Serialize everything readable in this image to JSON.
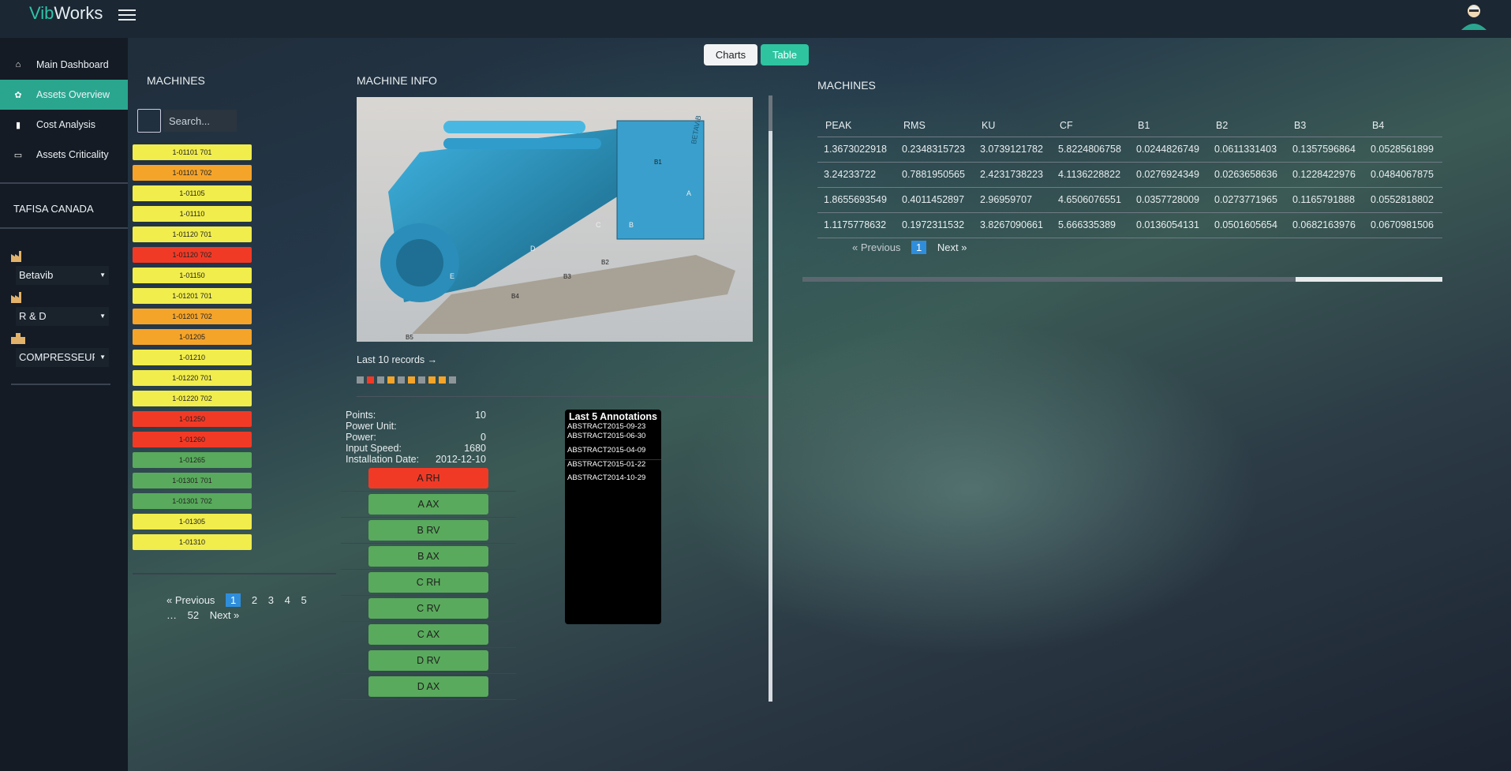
{
  "app": {
    "logo_part1": "Vib",
    "logo_part2": "Works"
  },
  "sidebar": {
    "nav": [
      {
        "label": "Main Dashboard",
        "icon": "home-icon",
        "glyph": "⌂"
      },
      {
        "label": "Assets Overview",
        "icon": "gear-icon",
        "glyph": "✿"
      },
      {
        "label": "Cost Analysis",
        "icon": "bar-chart-icon",
        "glyph": "▮"
      },
      {
        "label": "Assets Criticality",
        "icon": "monitor-icon",
        "glyph": "▭"
      }
    ],
    "company": "TAFISA CANADA",
    "selects": [
      {
        "value": "Betavib",
        "icon": "factory-icon"
      },
      {
        "value": "R & D",
        "icon": "factory-icon"
      },
      {
        "value": "COMPRESSEUR",
        "icon": "building-icon"
      }
    ]
  },
  "machines_panel": {
    "title": "MACHINES",
    "search_placeholder": "Search...",
    "items": [
      {
        "label": "1-01101 701",
        "color": "yellow"
      },
      {
        "label": "1-01101 702",
        "color": "orange"
      },
      {
        "label": "1-01105",
        "color": "yellow"
      },
      {
        "label": "1-01110",
        "color": "yellow"
      },
      {
        "label": "1-01120 701",
        "color": "yellow"
      },
      {
        "label": "1-01120 702",
        "color": "red"
      },
      {
        "label": "1-01150",
        "color": "yellow"
      },
      {
        "label": "1-01201 701",
        "color": "yellow"
      },
      {
        "label": "1-01201 702",
        "color": "orange"
      },
      {
        "label": "1-01205",
        "color": "orange"
      },
      {
        "label": "1-01210",
        "color": "yellow"
      },
      {
        "label": "1-01220 701",
        "color": "yellow"
      },
      {
        "label": "1-01220 702",
        "color": "yellow"
      },
      {
        "label": "1-01250",
        "color": "red"
      },
      {
        "label": "1-01260",
        "color": "red"
      },
      {
        "label": "1-01265",
        "color": "green"
      },
      {
        "label": "1-01301 701",
        "color": "green"
      },
      {
        "label": "1-01301 702",
        "color": "green"
      },
      {
        "label": "1-01305",
        "color": "yellow"
      },
      {
        "label": "1-01310",
        "color": "yellow"
      }
    ],
    "pager": {
      "prev": "« Previous",
      "pages": [
        "1",
        "2",
        "3",
        "4",
        "5"
      ],
      "active": "1",
      "ellipsis": "…",
      "last": "52",
      "next": "Next »"
    }
  },
  "machine_info": {
    "title": "MACHINE INFO",
    "last_records": "Last 10 records →",
    "status_colors": [
      "#8e9599",
      "#f13a26",
      "#8e9599",
      "#f5a42a",
      "#8e9599",
      "#f5a42a",
      "#8e9599",
      "#f5a42a",
      "#f5a42a",
      "#8e9599"
    ],
    "image_labels": [
      "B1",
      "A",
      "C",
      "B",
      "D",
      "E",
      "B2",
      "B3",
      "B4",
      "B5"
    ],
    "brand_text": "BETAVIB",
    "stats": [
      {
        "label": "Points:",
        "value": "10"
      },
      {
        "label": "Power Unit:",
        "value": ""
      },
      {
        "label": "Power:",
        "value": "0"
      },
      {
        "label": "Input Speed:",
        "value": "1680"
      },
      {
        "label": "Installation Date:",
        "value": "2012-12-10"
      }
    ],
    "measurements": [
      {
        "label": "A RH",
        "color": "red"
      },
      {
        "label": "A AX",
        "color": "green"
      },
      {
        "label": "B RV",
        "color": "green"
      },
      {
        "label": "B AX",
        "color": "green"
      },
      {
        "label": "C RH",
        "color": "green"
      },
      {
        "label": "C RV",
        "color": "green"
      },
      {
        "label": "C AX",
        "color": "green"
      },
      {
        "label": "D RV",
        "color": "green"
      },
      {
        "label": "D AX",
        "color": "green"
      }
    ],
    "annotations": {
      "title": "Last 5 Annotations",
      "items": [
        "ABSTRACT2015-09-23",
        "ABSTRACT2015-06-30",
        "ABSTRACT2015-04-09",
        "ABSTRACT2015-01-22",
        "ABSTRACT2014-10-29"
      ]
    }
  },
  "view_toggle": {
    "charts": "Charts",
    "table": "Table",
    "active": "Table"
  },
  "table_panel": {
    "title": "MACHINES",
    "columns": [
      "PEAK",
      "RMS",
      "KU",
      "CF",
      "B1",
      "B2",
      "B3",
      "B4"
    ],
    "rows": [
      [
        "1.3673022918",
        "0.2348315723",
        "3.0739121782",
        "5.8224806758",
        "0.0244826749",
        "0.0611331403",
        "0.1357596864",
        "0.0528561899"
      ],
      [
        "3.24233722",
        "0.7881950565",
        "2.4231738223",
        "4.1136228822",
        "0.0276924349",
        "0.0263658636",
        "0.1228422976",
        "0.0484067875"
      ],
      [
        "1.8655693549",
        "0.4011452897",
        "2.96959707",
        "4.6506076551",
        "0.0357728009",
        "0.0273771965",
        "0.1165791888",
        "0.0552818802"
      ],
      [
        "1.1175778632",
        "0.1972311532",
        "3.8267090661",
        "5.666335389",
        "0.0136054131",
        "0.0501605654",
        "0.0682163976",
        "0.0670981506"
      ]
    ],
    "pager": {
      "prev": "« Previous",
      "page": "1",
      "next": "Next »"
    }
  },
  "colors": {
    "accent": "#2ec4a0",
    "yellow": "#f1ed4c",
    "orange": "#f5a42a",
    "red": "#f13a26",
    "green": "#59aa5c"
  }
}
